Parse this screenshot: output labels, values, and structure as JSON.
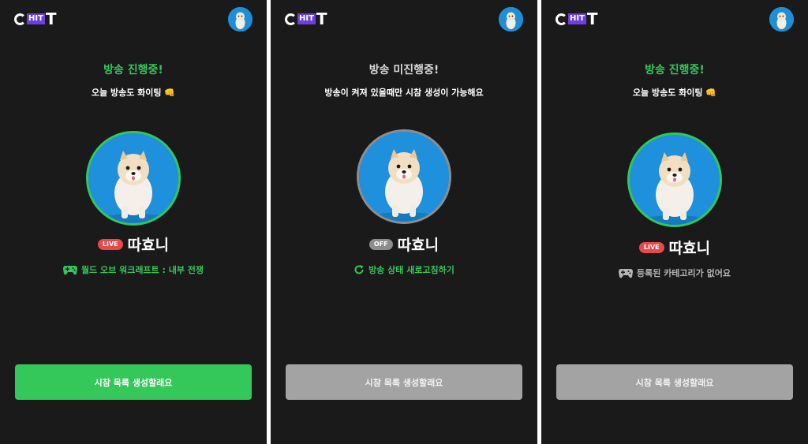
{
  "app": {
    "logo_text": "C",
    "logo_hit": "HIT",
    "logo_tail": "T"
  },
  "colors": {
    "accent_green": "#34c759",
    "live_red": "#e8494a",
    "off_gray": "#8d8d8d",
    "button_disabled": "#a3a3a3",
    "panel_bg": "#1a1a1b"
  },
  "screens": [
    {
      "headline": "방송 진행중!",
      "subtext": "오늘 방송도 화이팅 👊",
      "status_badge": "LIVE",
      "streamer_name": "따효니",
      "info_icon": "gamepad-icon",
      "info_text": "월드 오브 워크래프트 : 내부 전쟁",
      "button_label": "시참 목록 생성할래요",
      "button_enabled": true
    },
    {
      "headline": "방송 미진행중!",
      "subtext": "방송이 켜져 있을때만 시참 생성이 가능해요",
      "status_badge": "OFF",
      "streamer_name": "따효니",
      "info_icon": "refresh-icon",
      "info_text": "방송 상태 새로고침하기",
      "button_label": "시참 목록 생성할래요",
      "button_enabled": false
    },
    {
      "headline": "방송 진행중!",
      "subtext": "오늘 방송도 화이팅 👊",
      "status_badge": "LIVE",
      "streamer_name": "따효니",
      "info_icon": "gamepad-icon",
      "info_text": "등록된 카테고리가 없어요",
      "button_label": "시참 목록 생성할래요",
      "button_enabled": false
    }
  ]
}
